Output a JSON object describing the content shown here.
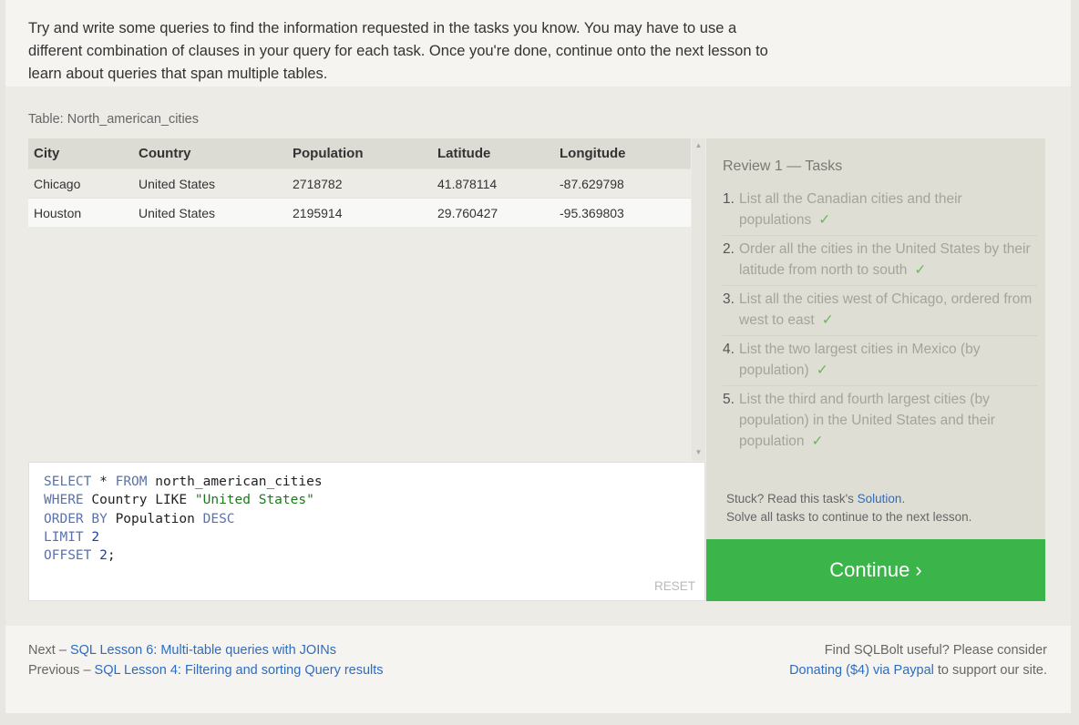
{
  "intro": {
    "text": "Try and write some queries to find the information requested in the tasks you know. You may have to use a different combination of clauses in your query for each task. Once you're done, continue onto the next lesson to learn about queries that span multiple tables."
  },
  "table": {
    "label": "Table: North_american_cities",
    "columns": [
      "City",
      "Country",
      "Population",
      "Latitude",
      "Longitude"
    ],
    "rows": [
      [
        "Chicago",
        "United States",
        "2718782",
        "41.878114",
        "-87.629798"
      ],
      [
        "Houston",
        "United States",
        "2195914",
        "29.760427",
        "-95.369803"
      ]
    ]
  },
  "editor": {
    "lines": [
      [
        "SELECT",
        " * ",
        "FROM",
        " north_american_cities"
      ],
      [
        "WHERE",
        " Country LIKE ",
        "\"United States\""
      ],
      [
        "ORDER BY",
        " Population ",
        "DESC"
      ],
      [
        "LIMIT",
        " ",
        "2"
      ],
      [
        "OFFSET",
        " ",
        "2",
        ";"
      ]
    ],
    "reset_label": "RESET"
  },
  "tasks": {
    "title": "Review 1 — Tasks",
    "check_mark": "✓",
    "items": [
      {
        "num": "1.",
        "text": "List all the Canadian cities and their populations"
      },
      {
        "num": "2.",
        "text": "Order all the cities in the United States by their latitude from north to south"
      },
      {
        "num": "3.",
        "text": "List all the cities west of Chicago, ordered from west to east"
      },
      {
        "num": "4.",
        "text": "List the two largest cities in Mexico (by population)"
      },
      {
        "num": "5.",
        "text": "List the third and fourth largest cities (by population) in the United States and their population"
      }
    ],
    "stuck_prefix": "Stuck? Read this task's ",
    "solution_link": "Solution",
    "stuck_suffix": ".",
    "solve_all": "Solve all tasks to continue to the next lesson."
  },
  "continue_label": "Continue ›",
  "footer": {
    "next_prefix": "Next – ",
    "next_link": "SQL Lesson 6: Multi-table queries with JOINs",
    "prev_prefix": "Previous – ",
    "prev_link": "SQL Lesson 4: Filtering and sorting Query results",
    "useful_text": "Find SQLBolt useful? Please consider",
    "donate_link": "Donating ($4) via Paypal",
    "donate_suffix": " to support our site."
  },
  "colors": {
    "continue_bg": "#3bb549",
    "link": "#2d6cc0",
    "check": "#6cb85c"
  }
}
